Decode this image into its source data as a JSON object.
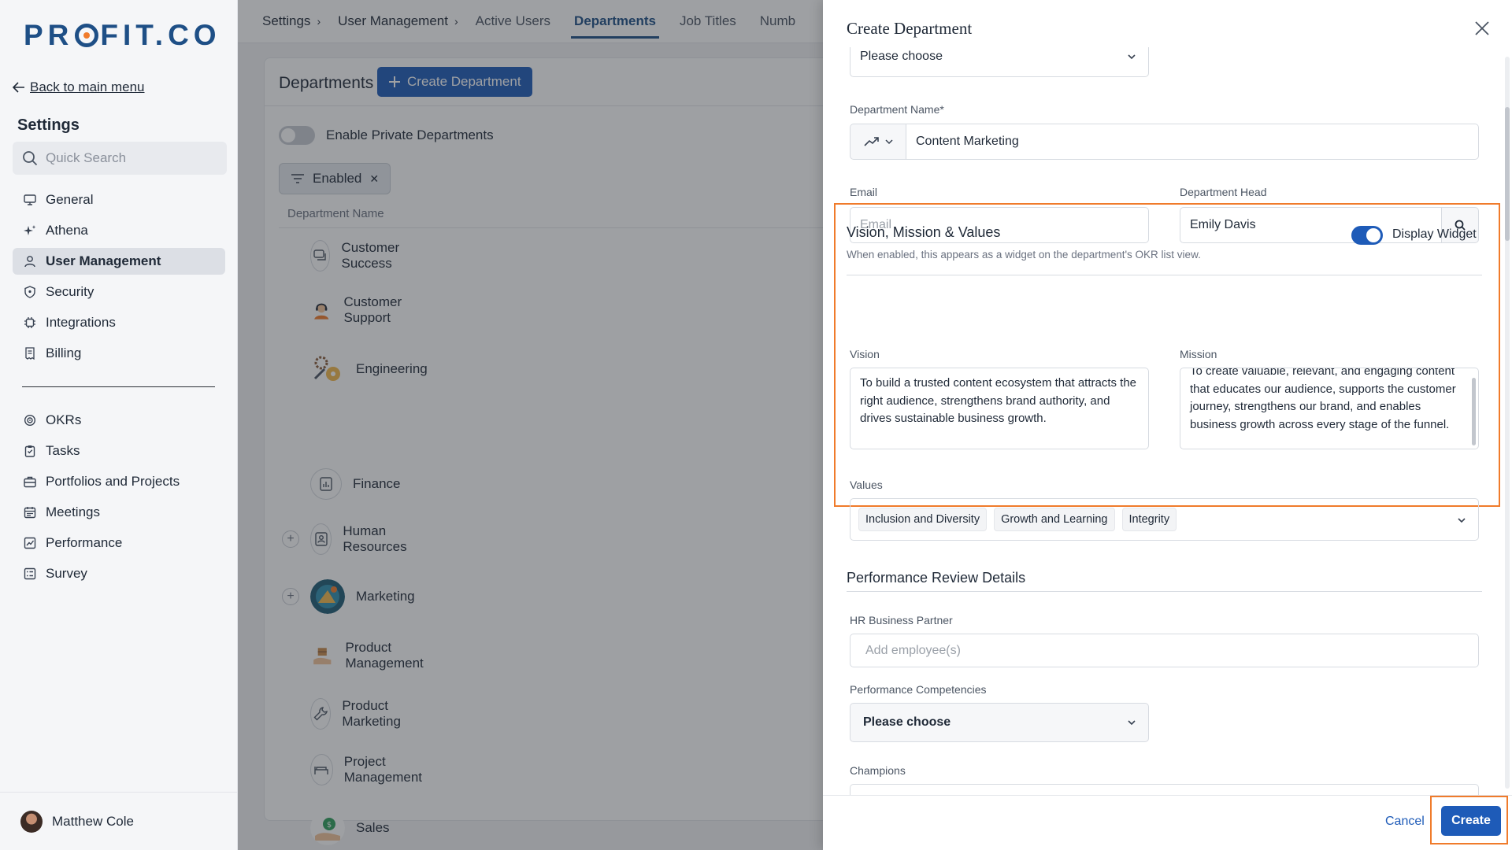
{
  "brand": {
    "logo_text_left": "PR",
    "logo_text_right": "FIT.CO",
    "accent": "#1e4f86",
    "highlight": "#f07b2b",
    "primary": "#1e5bb8"
  },
  "sidebar": {
    "back_label": "Back to main menu",
    "section_title": "Settings",
    "search_placeholder": "Quick Search",
    "items_top": [
      {
        "label": "General",
        "icon": "monitor-icon"
      },
      {
        "label": "Athena",
        "icon": "sparkle-icon"
      },
      {
        "label": "User Management",
        "icon": "user-icon",
        "active": true
      },
      {
        "label": "Security",
        "icon": "shield-icon"
      },
      {
        "label": "Integrations",
        "icon": "chip-icon"
      },
      {
        "label": "Billing",
        "icon": "receipt-icon"
      }
    ],
    "items_bottom": [
      {
        "label": "OKRs",
        "icon": "target-icon"
      },
      {
        "label": "Tasks",
        "icon": "clipboard-icon"
      },
      {
        "label": "Portfolios and Projects",
        "icon": "briefcase-icon"
      },
      {
        "label": "Meetings",
        "icon": "calendar-icon"
      },
      {
        "label": "Performance",
        "icon": "chart-icon"
      },
      {
        "label": "Survey",
        "icon": "survey-icon"
      }
    ],
    "user_name": "Matthew Cole"
  },
  "topnav": {
    "breadcrumb": [
      "Settings",
      "User Management"
    ],
    "tabs": [
      "Active Users",
      "Departments",
      "Job Titles",
      "Numb"
    ],
    "active_tab": "Departments"
  },
  "departments_page": {
    "title": "Departments",
    "create_button": "Create Department",
    "private_toggle_label": "Enable Private Departments",
    "filter_chip": "Enabled",
    "column_header": "Department Name",
    "list": [
      {
        "name": "Customer Success",
        "icon": "chat-icon"
      },
      {
        "name": "Customer Support",
        "icon": "support-agent-icon"
      },
      {
        "name": "Engineering",
        "icon": "engineering-icon"
      },
      {
        "name": "Finance",
        "icon": "finance-chart-icon"
      },
      {
        "name": "Human Resources",
        "icon": "id-card-icon",
        "expandable": true
      },
      {
        "name": "Marketing",
        "icon": "marketing-icon",
        "expandable": true
      },
      {
        "name": "Product Management",
        "icon": "product-box-icon"
      },
      {
        "name": "Product Marketing",
        "icon": "wrench-icon"
      },
      {
        "name": "Project Management",
        "icon": "bed-icon"
      },
      {
        "name": "Sales",
        "icon": "sales-icon"
      }
    ]
  },
  "drawer": {
    "title": "Create Department",
    "parent_select_value": "Please choose",
    "department_name_label": "Department Name*",
    "department_name_value": "Content Marketing",
    "email_label": "Email",
    "email_placeholder": "Email",
    "head_label": "Department Head",
    "head_value": "Emily  Davis",
    "vmv": {
      "title": "Vision, Mission & Values",
      "subtitle": "When enabled, this appears as a widget on the department's OKR list view.",
      "widget_label": "Display Widget",
      "widget_enabled": true,
      "vision_label": "Vision",
      "vision_value": "To build a trusted content ecosystem that attracts the right audience, strengthens brand authority, and drives sustainable business growth.",
      "mission_label": "Mission",
      "mission_value": "To create valuable, relevant, and engaging content that educates our audience, supports the customer journey, strengthens our brand, and enables business growth across every stage of the funnel.",
      "values_label": "Values",
      "values": [
        "Inclusion and Diversity",
        "Growth and Learning",
        "Integrity"
      ]
    },
    "performance": {
      "title": "Performance Review Details",
      "hr_partner_label": "HR Business Partner",
      "hr_partner_placeholder": "Add employee(s)",
      "competencies_label": "Performance Competencies",
      "competencies_value": "Please choose",
      "champions_label": "Champions"
    },
    "cancel_label": "Cancel",
    "create_label": "Create"
  }
}
